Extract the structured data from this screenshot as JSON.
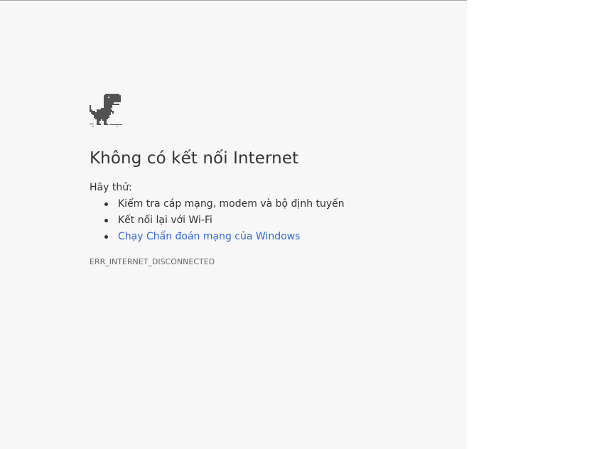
{
  "error_page": {
    "title": "Không có kết nối Internet",
    "try_label": "Hãy thử:",
    "suggestions": [
      {
        "text": "Kiểm tra cáp mạng, modem và bộ định tuyến"
      },
      {
        "text": "Kết nối lại với Wi-Fi"
      },
      {
        "text": "Chạy Chẩn đoán mạng của Windows",
        "link": true
      }
    ],
    "error_code": "ERR_INTERNET_DISCONNECTED",
    "icon": "offline-dinosaur-icon"
  },
  "colors": {
    "page_background": "#f7f7f7",
    "text": "#333333",
    "link": "#3367d6",
    "error_code": "#646464"
  }
}
